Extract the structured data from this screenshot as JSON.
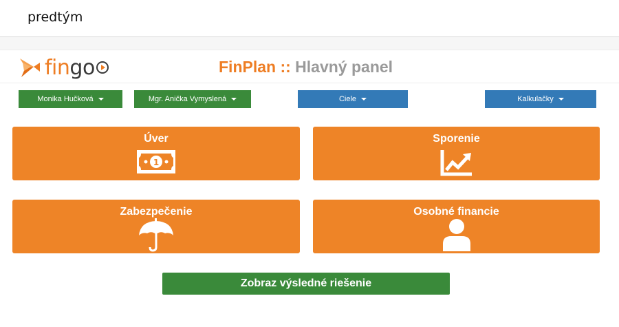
{
  "caption": "predtým",
  "logo": {
    "text_fin": "fin",
    "text_go": "go"
  },
  "app_title": {
    "brand": "FinPlan",
    "separator": "::",
    "panel": "Hlavný panel"
  },
  "nav": {
    "client_label": "Monika Hučková",
    "advisor_label": "Mgr. Anička Vymyslená",
    "goals_label": "Ciele",
    "calculators_label": "Kalkulačky"
  },
  "tiles": {
    "loan": {
      "title": "Úver",
      "icon": "banknote-icon"
    },
    "savings": {
      "title": "Sporenie",
      "icon": "trend-chart-icon"
    },
    "insurance": {
      "title": "Zabezpečenie",
      "icon": "umbrella-icon"
    },
    "personal": {
      "title": "Osobné financie",
      "icon": "user-icon"
    }
  },
  "solve_button": "Zobraz výsledné riešenie",
  "colors": {
    "orange": "#ee8427",
    "green": "#3a8a3a",
    "blue": "#337ab7",
    "gray_text": "#9a9a9a"
  }
}
